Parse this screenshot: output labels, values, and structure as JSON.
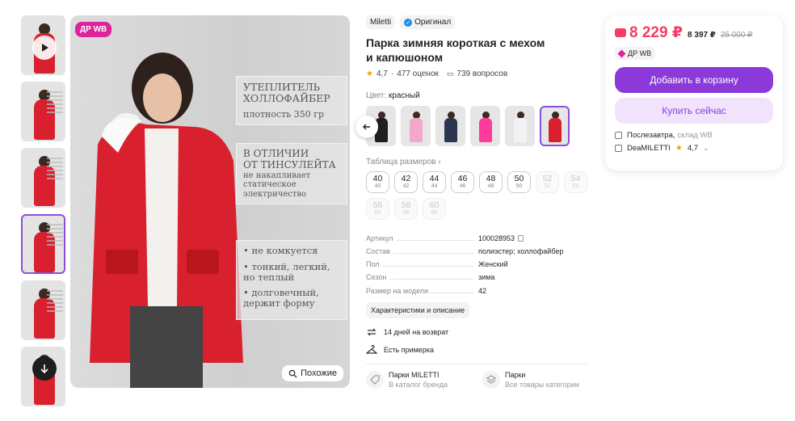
{
  "gallery": {
    "badge": "ДР WB",
    "similar_label": "Похожие",
    "promo": {
      "b1_line1": "УТЕПЛИТЕЛЬ",
      "b1_line2": "ХОЛЛОФАЙБЕР",
      "b1_line3": "плотность 350 гр",
      "b2_line1": "В ОТЛИЧИИ",
      "b2_line2": "ОТ ТИНСУЛЕЙТА",
      "b2_line3": "не накапливает",
      "b2_line4": "статическое",
      "b2_line5": "электричество",
      "b3_line1": "• не комкуется",
      "b3_line2": "• тонкий, легкий,",
      "b3_line3": "но теплый",
      "b3_line4": "• долговечный,",
      "b3_line5": "держит форму"
    }
  },
  "product": {
    "brand": "Miletti",
    "original_label": "Оригинал",
    "title": "Парка зимняя короткая с мехом и капюшоном",
    "rating": "4,7",
    "reviews": "477 оценок",
    "questions": "739 вопросов",
    "color_label": "Цвет:",
    "color_value": "красный",
    "swatches": [
      {
        "color": "#1f1f1f"
      },
      {
        "color": "#f2a8c8"
      },
      {
        "color": "#2a3550"
      },
      {
        "color": "#ff3a9a"
      },
      {
        "color": "#f2f2f2"
      },
      {
        "color": "#d8202e"
      }
    ],
    "size_table_label": "Таблица размеров",
    "sizes": [
      {
        "size": "40",
        "ru": "40",
        "available": true
      },
      {
        "size": "42",
        "ru": "42",
        "available": true
      },
      {
        "size": "44",
        "ru": "44",
        "available": true
      },
      {
        "size": "46",
        "ru": "46",
        "available": true
      },
      {
        "size": "48",
        "ru": "48",
        "available": true
      },
      {
        "size": "50",
        "ru": "50",
        "available": true
      },
      {
        "size": "52",
        "ru": "52",
        "available": false
      },
      {
        "size": "54",
        "ru": "54",
        "available": false
      },
      {
        "size": "56",
        "ru": "56",
        "available": false
      },
      {
        "size": "58",
        "ru": "58",
        "available": false
      },
      {
        "size": "60",
        "ru": "60",
        "available": false
      }
    ],
    "params": [
      {
        "key": "Артикул",
        "value": "100028953"
      },
      {
        "key": "Состав",
        "value": "полиэстер; холлофайбер"
      },
      {
        "key": "Пол",
        "value": "Женский"
      },
      {
        "key": "Сезон",
        "value": "зима"
      },
      {
        "key": "Размер на модели",
        "value": "42"
      }
    ],
    "characteristics_button": "Характеристики и описание",
    "return_text": "14 дней на возврат",
    "fitting_text": "Есть примерка",
    "link1_title": "Парки MILETTI",
    "link1_sub": "В каталог бренда",
    "link2_title": "Парки",
    "link2_sub": "Все товары категории"
  },
  "buy": {
    "price": "8 229 ₽",
    "price_no_wallet": "8 397 ₽",
    "price_old": "25 000 ₽",
    "badge": "ДР WB",
    "add_to_cart": "Добавить в корзину",
    "buy_now": "Купить сейчас",
    "delivery_day": "Послезавтра,",
    "delivery_wh": "склад WB",
    "seller": "DeaMILETTI",
    "seller_rating": "4,7"
  },
  "colors": {
    "accent": "#8b3ad9",
    "price": "#f53c67",
    "badge": "#e0229c",
    "jacket": "#d8202e"
  }
}
